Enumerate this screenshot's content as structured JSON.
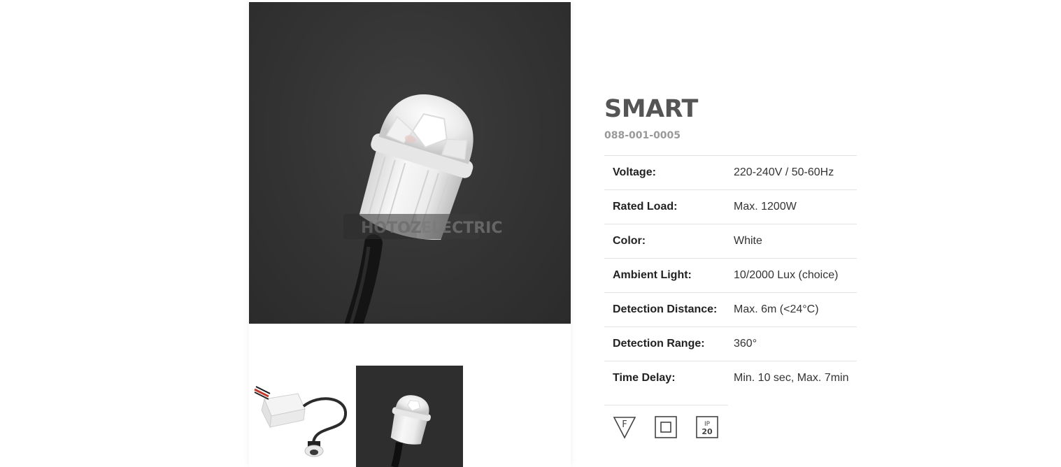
{
  "product": {
    "title": "SMART",
    "code": "088-001-0005"
  },
  "gallery": {
    "watermark_left": "HOTOZ",
    "watermark_right": "ELECTRIC",
    "thumbnails": [
      {
        "name": "sensor with junction box"
      },
      {
        "name": "sensor dome close-up"
      }
    ]
  },
  "specs": [
    {
      "label": "Voltage:",
      "value": "220-240V / 50-60Hz"
    },
    {
      "label": "Rated Load:",
      "value": "Max. 1200W"
    },
    {
      "label": "Color:",
      "value": "White"
    },
    {
      "label": "Ambient Light:",
      "value": "10/2000 Lux (choice)"
    },
    {
      "label": "Detection Distance:",
      "value": "Max. 6m (<24°C)"
    },
    {
      "label": "Detection Range:",
      "value": "360°"
    },
    {
      "label": "Time Delay:",
      "value": "Min. 10 sec, Max. 7min"
    }
  ],
  "certifications": [
    {
      "icon": "f-mark-icon",
      "text": "F"
    },
    {
      "icon": "double-insulation-icon",
      "text": ""
    },
    {
      "icon": "ip-rating-icon",
      "text_top": "IP",
      "text_bottom": "20"
    }
  ],
  "colors": {
    "title": "#555555",
    "code": "#999999",
    "photo_background": "#333333"
  }
}
